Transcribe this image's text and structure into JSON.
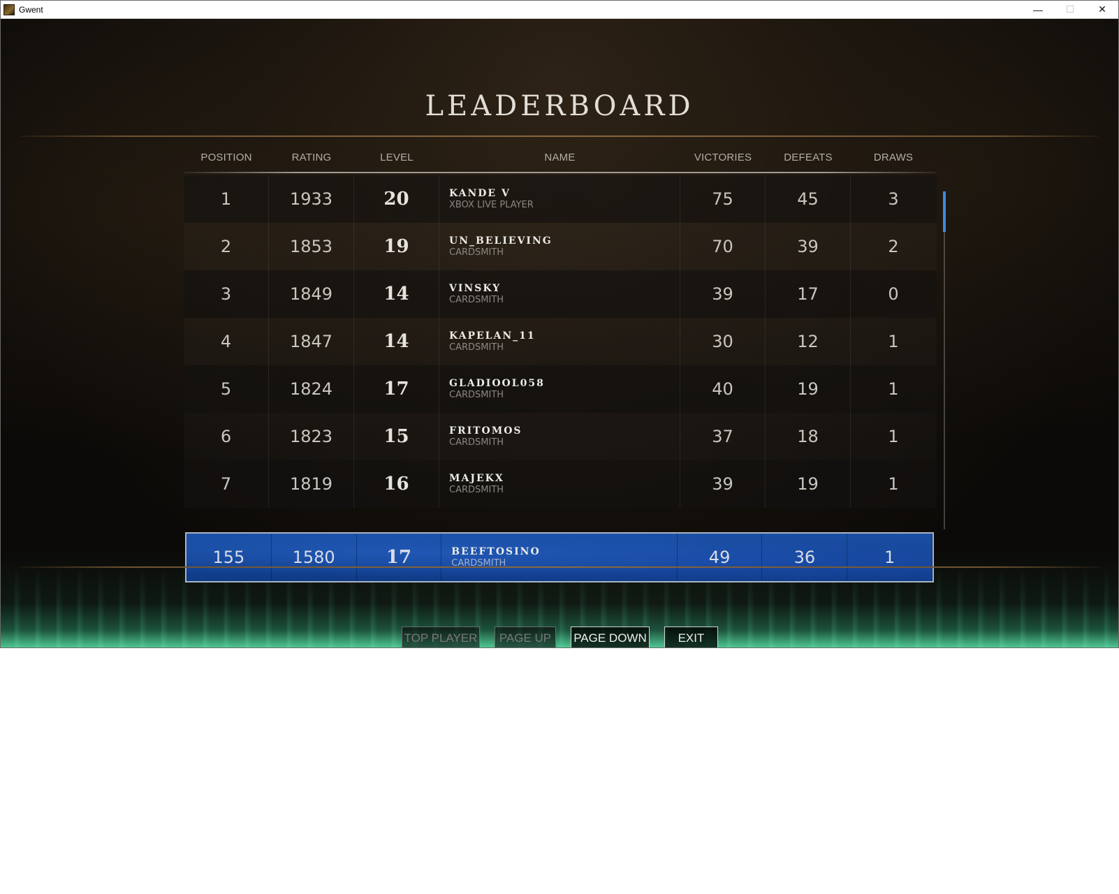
{
  "window": {
    "title": "Gwent",
    "controls": {
      "minimize": "—",
      "maximize": "☐",
      "close": "✕"
    }
  },
  "screen": {
    "title": "LEADERBOARD"
  },
  "table": {
    "headers": {
      "position": "POSITION",
      "rating": "RATING",
      "level": "LEVEL",
      "name": "NAME",
      "victories": "VICTORIES",
      "defeats": "DEFEATS",
      "draws": "DRAWS"
    },
    "rows": [
      {
        "position": "1",
        "rating": "1933",
        "level": "20",
        "name": "KANDE V",
        "title": "XBOX LIVE PLAYER",
        "victories": "75",
        "defeats": "45",
        "draws": "3"
      },
      {
        "position": "2",
        "rating": "1853",
        "level": "19",
        "name": "UN_BELIEVING",
        "title": "CARDSMITH",
        "victories": "70",
        "defeats": "39",
        "draws": "2"
      },
      {
        "position": "3",
        "rating": "1849",
        "level": "14",
        "name": "VINSKY",
        "title": "CARDSMITH",
        "victories": "39",
        "defeats": "17",
        "draws": "0"
      },
      {
        "position": "4",
        "rating": "1847",
        "level": "14",
        "name": "KAPELAN_11",
        "title": "CARDSMITH",
        "victories": "30",
        "defeats": "12",
        "draws": "1"
      },
      {
        "position": "5",
        "rating": "1824",
        "level": "17",
        "name": "GLADIOOL058",
        "title": "CARDSMITH",
        "victories": "40",
        "defeats": "19",
        "draws": "1"
      },
      {
        "position": "6",
        "rating": "1823",
        "level": "15",
        "name": "FRITOMOS",
        "title": "CARDSMITH",
        "victories": "37",
        "defeats": "18",
        "draws": "1"
      },
      {
        "position": "7",
        "rating": "1819",
        "level": "16",
        "name": "MAJEKX",
        "title": "CARDSMITH",
        "victories": "39",
        "defeats": "19",
        "draws": "1"
      }
    ],
    "current_player": {
      "position": "155",
      "rating": "1580",
      "level": "17",
      "name": "BEEFTOSINO",
      "title": "CARDSMITH",
      "victories": "49",
      "defeats": "36",
      "draws": "1"
    }
  },
  "buttons": {
    "top_player": "TOP PLAYER",
    "page_up": "PAGE UP",
    "page_down": "PAGE DOWN",
    "exit": "EXIT"
  },
  "colors": {
    "highlight_row": "#1a4fa4",
    "scroll_thumb": "#3b8be0",
    "flames": "#5ae6aa"
  }
}
